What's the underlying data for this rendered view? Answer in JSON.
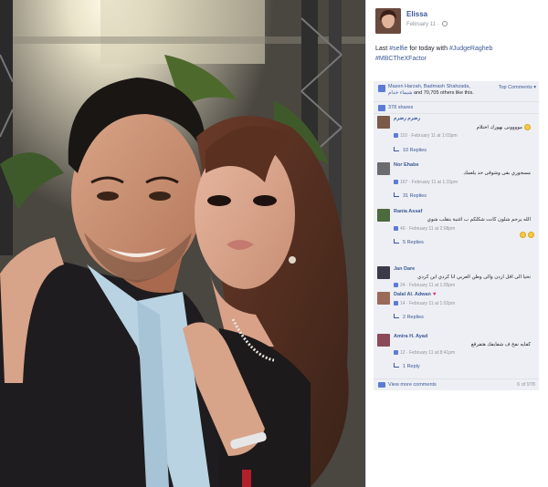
{
  "post": {
    "author": "Elissa",
    "date": "February 11 · ",
    "text_pre": "Last ",
    "tag_selfie": "#selfie",
    "text_mid": " for today with ",
    "tag_judge": "#JudgeRagheb",
    "tag_mbc": "#MBCTheXFactor"
  },
  "likes": {
    "names": "Mazen Harzah, Badmash Shahzada,",
    "names2": "شيماء خدام",
    "others": " and 70,705 others like this.",
    "top_comments": "Top Comments ▾"
  },
  "shares": {
    "label": "378 shares"
  },
  "comments": [
    {
      "name": "رضرم رضرم",
      "text": "موووونى بهورك اختلام",
      "time": "110 · February 11 at 1:03pm",
      "replies": "10 Replies",
      "emoji": "smile",
      "avatar_color": "#7a5a4a"
    },
    {
      "name": "Nor Ehabe",
      "text": "مسجوري بقى وشوقى حد يلعمك",
      "time": "167 · February 11 at 1:15pm",
      "replies": "31 Replies",
      "emoji": "",
      "avatar_color": "#6b6b70"
    },
    {
      "name": "Rania Assaf",
      "text": "الله يرحم شلون كانت شكلكم ب اغنية بتقلب شوي",
      "time": "40 · February 11 at 2:08pm",
      "replies": "5 Replies",
      "emoji": "smile2",
      "avatar_color": "#4d6a3c"
    },
    {
      "name": "Jan Dare",
      "text": "تحيا الى اقل اردن والى وطن العربي انا كردي اين كردي",
      "time": "24 · February 11 at 1:05pm",
      "replies": "",
      "emoji": "",
      "avatar_color": "#3a3a48"
    },
    {
      "name": "Dalal Al. Adwan",
      "text": "",
      "time": "14 · February 11 at 1:02pm",
      "replies": "2 Replies",
      "emoji": "heart",
      "avatar_color": "#9a6a58"
    },
    {
      "name": "Amira H. Ayad",
      "text": "كفايه نفخ ف شفايفك هتفرقع",
      "time": "12 · February 11 at 8:41pm",
      "replies": "1 Reply",
      "emoji": "",
      "avatar_color": "#8a4a5a"
    }
  ],
  "view_more": {
    "label": "View more comments",
    "count": "6 of 978"
  },
  "icons": {
    "globe": "globe-icon",
    "like": "like-icon",
    "share": "share-icon",
    "comment": "comment-icon"
  },
  "colors": {
    "link": "#3b5998",
    "ufi_bg": "#edeff4",
    "meta": "#90949c"
  }
}
